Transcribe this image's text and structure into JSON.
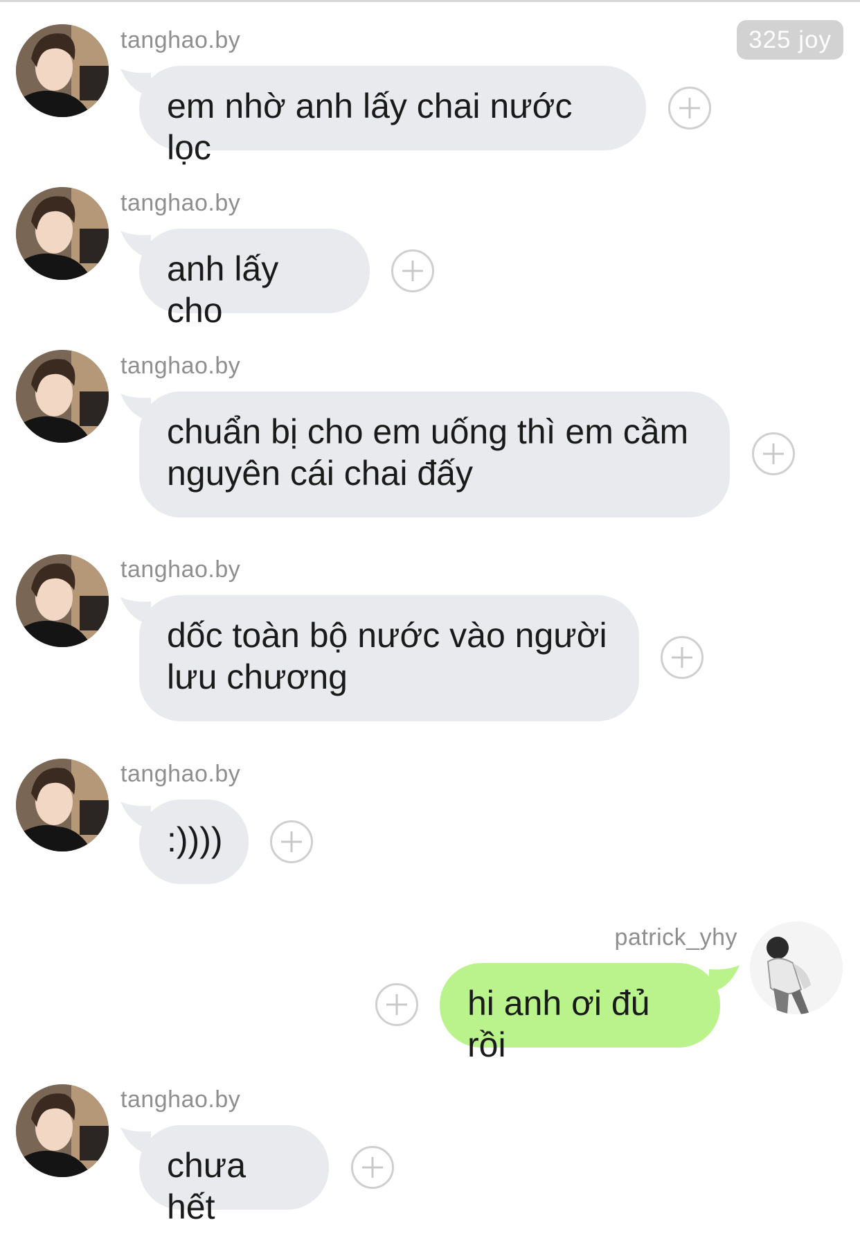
{
  "header": {
    "joy_count": "325 joy"
  },
  "colors": {
    "incoming_bubble": "#e9eaee",
    "outgoing_bubble": "#baf28c",
    "username_text": "#8e8e8e",
    "badge_background": "#d2d2d2"
  },
  "messages": [
    {
      "sender": "tanghao.by",
      "direction": "incoming",
      "text": "em nhờ anh lấy chai nước lọc",
      "action_icon": "plus-circle-icon"
    },
    {
      "sender": "tanghao.by",
      "direction": "incoming",
      "text": "anh lấy cho",
      "action_icon": "plus-circle-icon"
    },
    {
      "sender": "tanghao.by",
      "direction": "incoming",
      "text": "chuẩn bị cho em uống thì em cầm\nnguyên cái chai đấy",
      "action_icon": "plus-circle-icon"
    },
    {
      "sender": "tanghao.by",
      "direction": "incoming",
      "text": "dốc toàn bộ nước vào người\nlưu chương",
      "action_icon": "plus-circle-icon"
    },
    {
      "sender": "tanghao.by",
      "direction": "incoming",
      "text": ":))))",
      "action_icon": "plus-circle-icon"
    },
    {
      "sender": "patrick_yhy",
      "direction": "outgoing",
      "text": "hi anh ơi đủ rồi",
      "action_icon": "plus-circle-icon"
    },
    {
      "sender": "tanghao.by",
      "direction": "incoming",
      "text": "chưa hết",
      "action_icon": "plus-circle-icon"
    }
  ]
}
